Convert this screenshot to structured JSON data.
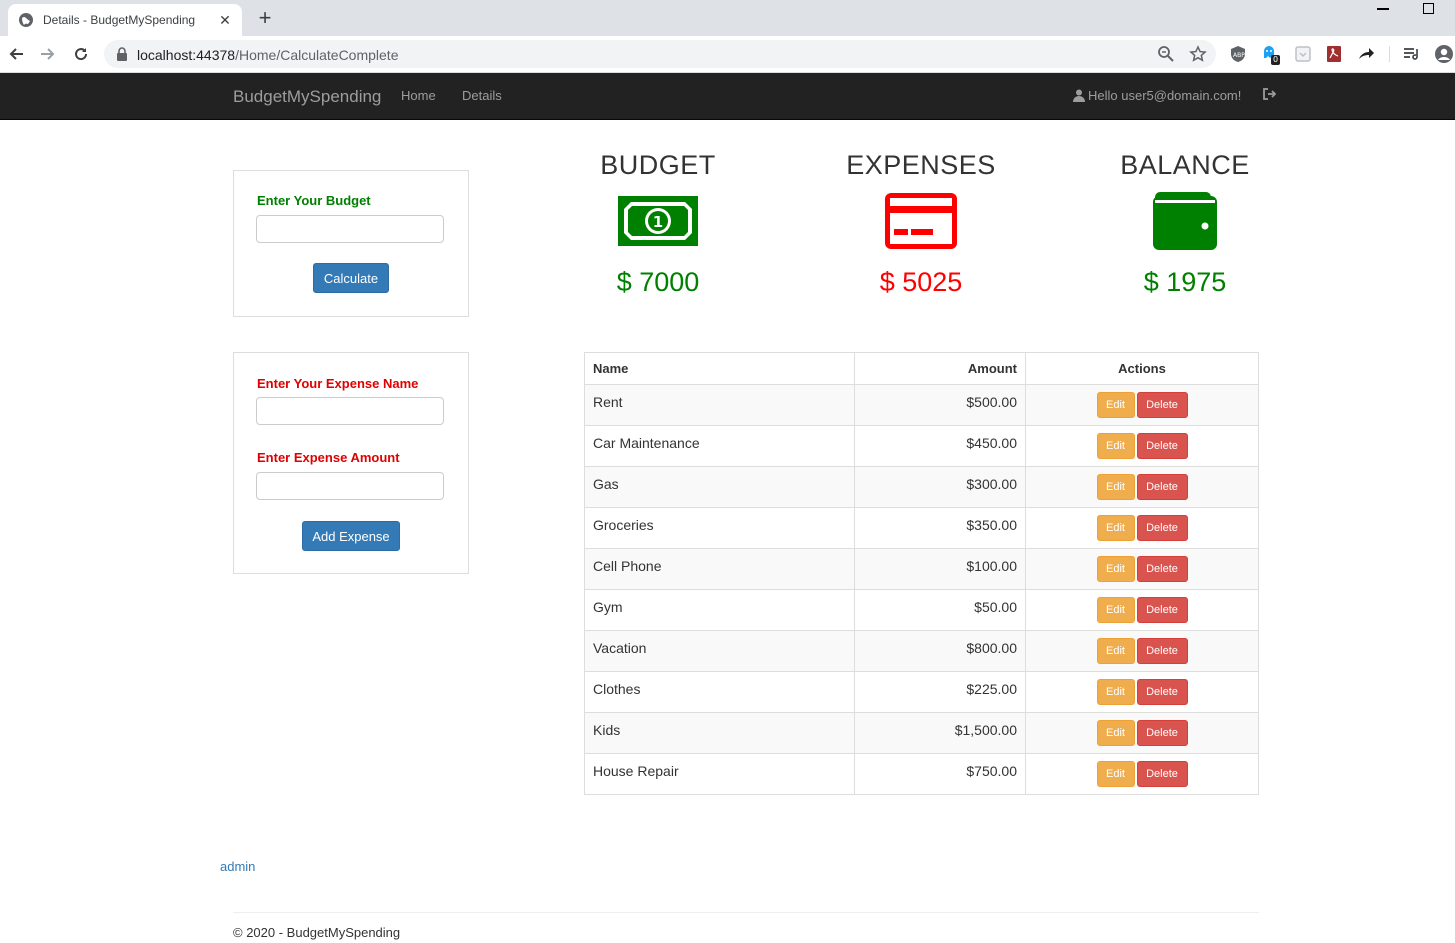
{
  "browser": {
    "tab_title": "Details - BudgetMySpending",
    "url_host": "localhost:44378",
    "url_path": "/Home/CalculateComplete",
    "extension_badge": "0"
  },
  "navbar": {
    "brand": "BudgetMySpending",
    "links": [
      "Home",
      "Details"
    ],
    "greeting": "Hello user5@domain.com!"
  },
  "budget_form": {
    "label": "Enter Your Budget",
    "value": "",
    "button": "Calculate"
  },
  "expense_form": {
    "name_label": "Enter Your Expense Name",
    "name_value": "",
    "amount_label": "Enter Expense Amount",
    "amount_value": "",
    "button": "Add Expense"
  },
  "summary": {
    "budget": {
      "title": "BUDGET",
      "value": "$ 7000",
      "icon": "money-bill-icon",
      "color": "#008000"
    },
    "expenses": {
      "title": "EXPENSES",
      "value": "$ 5025",
      "icon": "credit-card-icon",
      "color": "#ff0000"
    },
    "balance": {
      "title": "BALANCE",
      "value": "$ 1975",
      "icon": "wallet-icon",
      "color": "#008000"
    }
  },
  "table": {
    "headers": {
      "name": "Name",
      "amount": "Amount",
      "actions": "Actions"
    },
    "edit_label": "Edit",
    "delete_label": "Delete",
    "rows": [
      {
        "name": "Rent",
        "amount": "$500.00"
      },
      {
        "name": "Car Maintenance",
        "amount": "$450.00"
      },
      {
        "name": "Gas",
        "amount": "$300.00"
      },
      {
        "name": "Groceries",
        "amount": "$350.00"
      },
      {
        "name": "Cell Phone",
        "amount": "$100.00"
      },
      {
        "name": "Gym",
        "amount": "$50.00"
      },
      {
        "name": "Vacation",
        "amount": "$800.00"
      },
      {
        "name": "Clothes",
        "amount": "$225.00"
      },
      {
        "name": "Kids",
        "amount": "$1,500.00"
      },
      {
        "name": "House Repair",
        "amount": "$750.00"
      }
    ]
  },
  "footer": {
    "admin_link": "admin",
    "copyright": "© 2020 - BudgetMySpending"
  }
}
